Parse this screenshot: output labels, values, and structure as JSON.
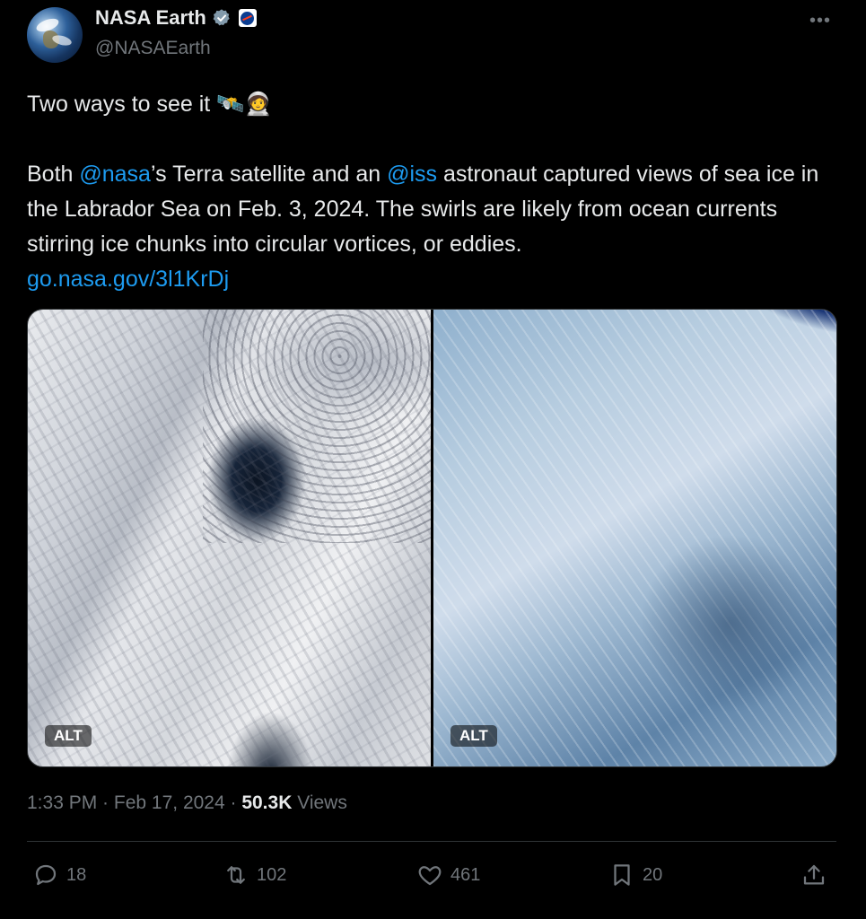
{
  "author": {
    "display_name": "NASA Earth",
    "handle": "@NASAEarth"
  },
  "tweet": {
    "line1": "Two ways to see it 🛰️🧑‍🚀",
    "body_parts": [
      "Both ",
      "@nasa",
      "’s Terra satellite and an ",
      "@iss",
      " astronaut captured views of sea ice in the Labrador Sea on Feb. 3, 2024. The swirls are likely from ocean currents stirring ice chunks into circular vortices, or eddies."
    ],
    "link": "go.nasa.gov/3l1KrDj"
  },
  "media": {
    "alt_left": "ALT",
    "alt_right": "ALT"
  },
  "meta": {
    "time": "1:33 PM",
    "sep1": " · ",
    "date": "Feb 17, 2024",
    "sep2": " · ",
    "views_count": "50.3K",
    "views_label": " Views"
  },
  "actions": {
    "replies": "18",
    "reposts": "102",
    "likes": "461",
    "bookmarks": "20"
  },
  "colors": {
    "accent": "#1d9bf0",
    "text": "#e7e9ea",
    "muted": "#71767b",
    "background": "#000000"
  },
  "icons": [
    "more-icon",
    "verified-icon",
    "nasa-badge-icon",
    "reply-icon",
    "repost-icon",
    "like-icon",
    "bookmark-icon",
    "share-icon"
  ]
}
